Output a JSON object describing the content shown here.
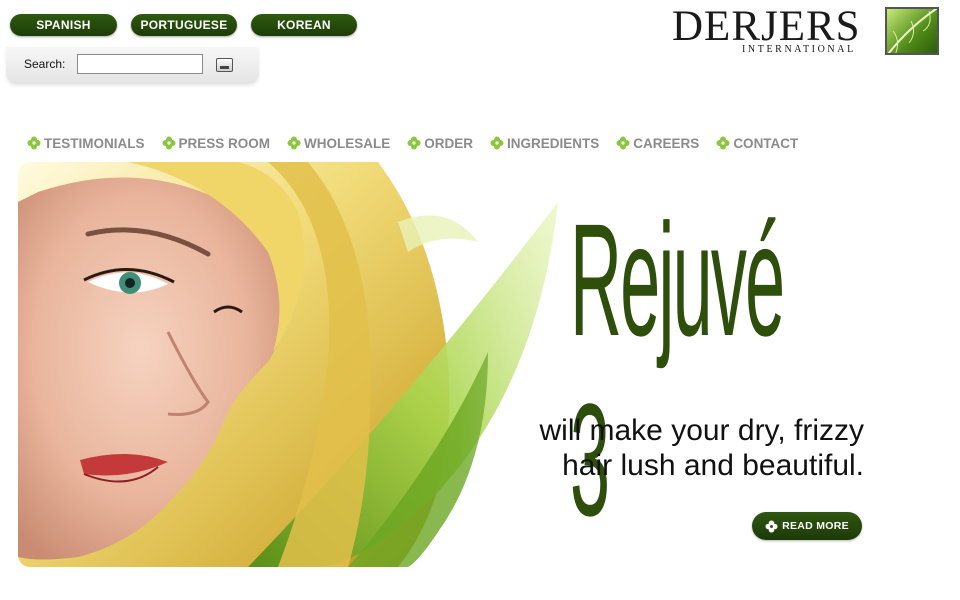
{
  "languages": [
    "SPANISH",
    "PORTUGUESE",
    "KOREAN"
  ],
  "search": {
    "label": "Search:",
    "value": "",
    "placeholder": ""
  },
  "logo": {
    "main": "DERJERS",
    "sub": "INTERNATIONAL"
  },
  "nav": [
    "TESTIMONIALS",
    "PRESS ROOM",
    "WHOLESALE",
    "ORDER",
    "INGREDIENTS",
    "CAREERS",
    "CONTACT"
  ],
  "hero": {
    "title": "Rejuvé 3",
    "line1": "will make your dry, frizzy",
    "line2": "hair lush and beautiful.",
    "button": "READ MORE"
  },
  "colors": {
    "brand_green": "#2e5a10",
    "nav_gray": "#8b8b8b",
    "leaf_green": "#8cc63f"
  }
}
